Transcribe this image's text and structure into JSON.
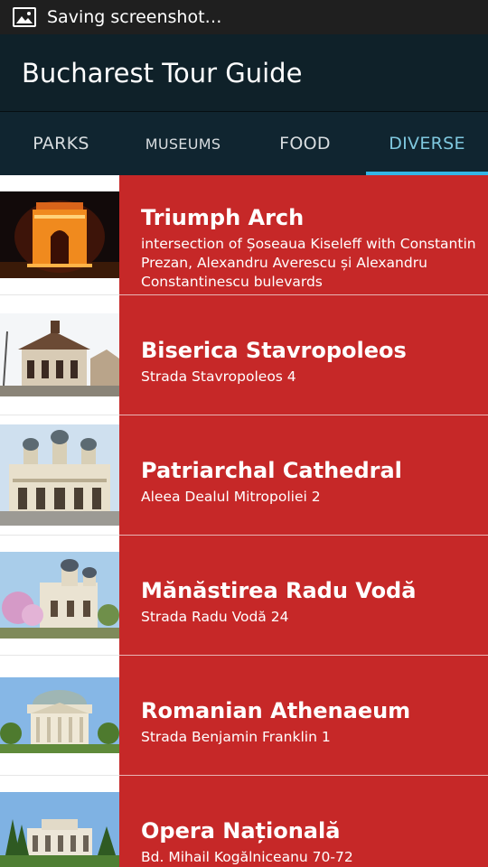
{
  "status_bar": {
    "text": "Saving screenshot…",
    "icon": "image-icon"
  },
  "app": {
    "title": "Bucharest Tour Guide"
  },
  "tabs": [
    {
      "label": "PARKS",
      "active": false
    },
    {
      "label": "MUSEUMS",
      "active": false
    },
    {
      "label": "FOOD",
      "active": false
    },
    {
      "label": "DIVERSE",
      "active": true
    }
  ],
  "places": [
    {
      "name": "Triumph Arch",
      "address": "intersection of Șoseaua Kiseleff with Constantin Prezan, Alexandru Averescu și Alexandru Constantinescu bulevards"
    },
    {
      "name": "Biserica Stavropoleos",
      "address": "Strada Stavropoleos 4"
    },
    {
      "name": "Patriarchal Cathedral",
      "address": "Aleea Dealul Mitropoliei 2"
    },
    {
      "name": "Mănăstirea Radu Vodă",
      "address": "Strada Radu Vodă 24"
    },
    {
      "name": "Romanian Athenaeum",
      "address": "Strada Benjamin Franklin 1"
    },
    {
      "name": "Opera Națională",
      "address": "Bd. Mihail Kogălniceanu 70-72"
    }
  ],
  "colors": {
    "action_bar": "#0f2129",
    "tab_bar": "#102530",
    "tab_indicator": "#33b5e5",
    "card": "#c62828"
  }
}
